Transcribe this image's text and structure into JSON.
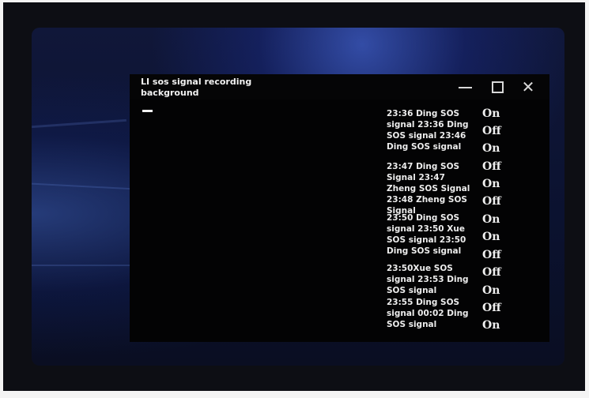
{
  "window": {
    "title": "LI sos signal recording background",
    "controls": {
      "minimize_icon": "minimize-icon",
      "maximize_icon": "maximize-icon",
      "close_icon": "close-icon",
      "close_glyph": "✕"
    }
  },
  "log_entries": [
    "23:36 Ding SOS signal 23:36 Ding SOS signal 23:46 Ding SOS signal",
    "23:47 Ding SOS Signal 23:47 Zheng SOS Signal 23:48 Zheng SOS Signal",
    "23:50 Ding SOS signal 23:50 Xue SOS signal 23:50 Ding SOS signal",
    "23:50Xue SOS signal 23:53 Ding SOS signal",
    "23:55 Ding SOS signal 00:02 Ding SOS signal"
  ],
  "statuses": [
    "On",
    "Off",
    "On",
    "Off",
    "On",
    "Off",
    "On",
    "On",
    "Off",
    "Off",
    "On",
    "Off",
    "On"
  ],
  "colors": {
    "window_bg": "#030304",
    "text": "#ececec",
    "desktop_accent": "#2b46c8"
  }
}
